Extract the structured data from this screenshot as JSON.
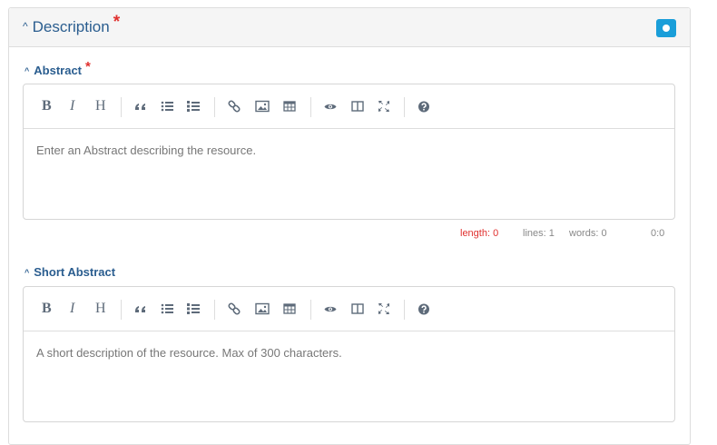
{
  "section": {
    "title": "Description",
    "required_mark": "*"
  },
  "fields": [
    {
      "label": "Abstract",
      "required_mark": "*",
      "placeholder": "Enter an Abstract describing the resource.",
      "status": {
        "length": "length: 0",
        "lines": "lines: 1",
        "words": "words: 0",
        "cursor": "0:0"
      }
    },
    {
      "label": "Short Abstract",
      "placeholder": "A short description of the resource. Max of 300 characters."
    }
  ],
  "toolbar": {
    "bold": "B",
    "italic": "I",
    "heading": "H",
    "icons": [
      "quote-icon",
      "unordered-list-icon",
      "ordered-list-icon",
      "link-icon",
      "image-icon",
      "table-icon",
      "preview-icon",
      "side-by-side-icon",
      "fullscreen-icon",
      "help-icon"
    ]
  },
  "colors": {
    "accent": "#2a5d8f",
    "required": "#e0312f",
    "toggle": "#1a9ed9",
    "length_warning": "#e0312f"
  }
}
